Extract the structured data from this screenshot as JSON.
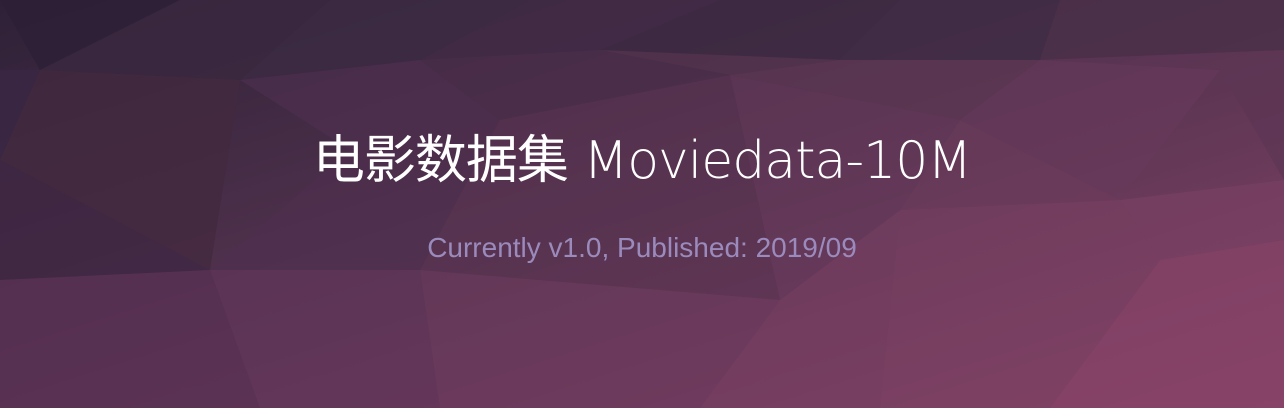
{
  "hero": {
    "title": "电影数据集 Moviedata-10M",
    "subtitle": "Currently v1.0, Published: 2019/09"
  },
  "colors": {
    "title": "#ffffff",
    "subtitle": "#9b8bbd",
    "background_dark": "#2f2238",
    "background_light": "#8a4268"
  }
}
